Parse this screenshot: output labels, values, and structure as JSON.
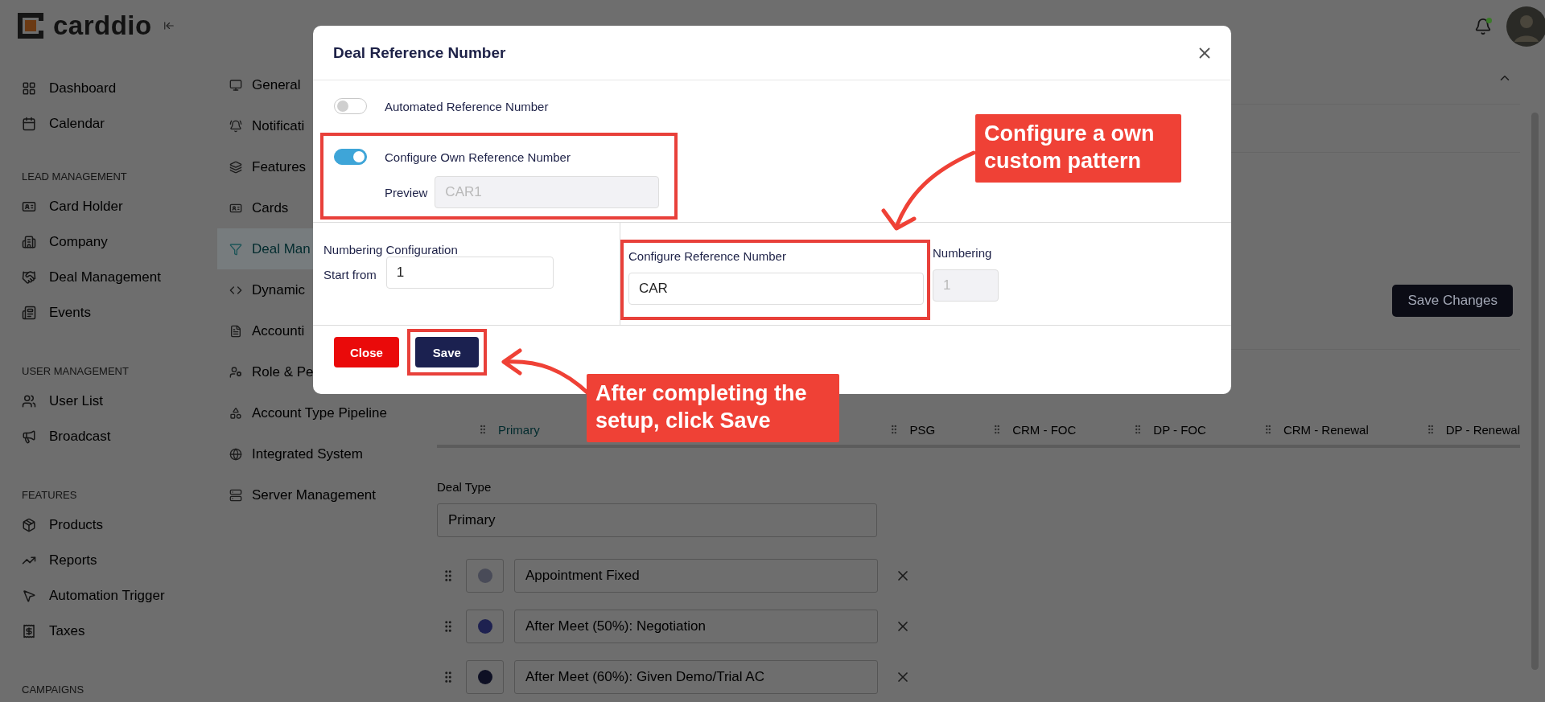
{
  "brand": {
    "logo": "carddio"
  },
  "sidebar": {
    "items": [
      {
        "kind": "item",
        "label": "Dashboard"
      },
      {
        "kind": "item",
        "label": "Calendar"
      },
      {
        "kind": "heading",
        "label": "LEAD MANAGEMENT"
      },
      {
        "kind": "item",
        "label": "Card Holder"
      },
      {
        "kind": "item",
        "label": "Company"
      },
      {
        "kind": "item",
        "label": "Deal Management"
      },
      {
        "kind": "item",
        "label": "Events"
      },
      {
        "kind": "heading",
        "label": "USER MANAGEMENT"
      },
      {
        "kind": "item",
        "label": "User List"
      },
      {
        "kind": "item",
        "label": "Broadcast"
      },
      {
        "kind": "heading",
        "label": "FEATURES"
      },
      {
        "kind": "item",
        "label": "Products"
      },
      {
        "kind": "item",
        "label": "Reports"
      },
      {
        "kind": "item",
        "label": "Automation Trigger"
      },
      {
        "kind": "item",
        "label": "Taxes"
      },
      {
        "kind": "heading",
        "label": "CAMPAIGNS"
      }
    ]
  },
  "settings_nav": {
    "items": [
      {
        "label": "General",
        "selected": false
      },
      {
        "label": "Notificati",
        "selected": false
      },
      {
        "label": "Features",
        "selected": false
      },
      {
        "label": "Cards",
        "selected": false
      },
      {
        "label": "Deal Man",
        "selected": true
      },
      {
        "label": "Dynamic",
        "selected": false
      },
      {
        "label": "Accounti",
        "selected": false
      },
      {
        "label": "Role & Pe",
        "selected": false
      },
      {
        "label": "Account Type Pipeline",
        "selected": false
      },
      {
        "label": "Integrated System",
        "selected": false
      },
      {
        "label": "Server Management",
        "selected": false
      }
    ]
  },
  "save_changes": "Save Changes",
  "tabs": [
    {
      "label": "Primary",
      "selected": true
    },
    {
      "label": "PSG",
      "selected": false
    },
    {
      "label": "CRM - FOC",
      "selected": false
    },
    {
      "label": "DP - FOC",
      "selected": false
    },
    {
      "label": "CRM - Renewal",
      "selected": false
    },
    {
      "label": "DP - Renewal",
      "selected": false
    }
  ],
  "deal_type": {
    "label": "Deal Type",
    "value": "Primary"
  },
  "stages": [
    {
      "name": "Appointment Fixed",
      "color": "#494b58"
    },
    {
      "name": "After Meet (50%): Negotiation",
      "color": "#1e2150"
    },
    {
      "name": "After Meet (60%): Given Demo/Trial AC",
      "color": "#0e1024"
    }
  ],
  "dialog": {
    "title": "Deal Reference Number",
    "options": [
      {
        "label": "Automated Reference Number",
        "on": false,
        "highlighted": false
      },
      {
        "label": "Configure Own Reference Number",
        "on": true,
        "highlighted": true,
        "preview": {
          "label": "Preview",
          "value": "CAR1",
          "disabled": true
        }
      }
    ],
    "numbering_configuration": {
      "heading": "Numbering Configuration",
      "label": "Start from",
      "value": "1",
      "disabled": false
    },
    "reference": {
      "label": "Configure Reference Number",
      "value": "CAR",
      "disabled": false,
      "highlighted": true
    },
    "numbering": {
      "label": "Numbering",
      "value": "1",
      "disabled": true
    },
    "buttons": [
      {
        "label": "Close",
        "kind": "danger",
        "highlighted": false
      },
      {
        "label": "Save",
        "kind": "primary",
        "highlighted": true
      }
    ]
  },
  "callouts": [
    {
      "text": "Configure a own custom pattern"
    },
    {
      "text": "After completing the setup, click Save"
    }
  ]
}
